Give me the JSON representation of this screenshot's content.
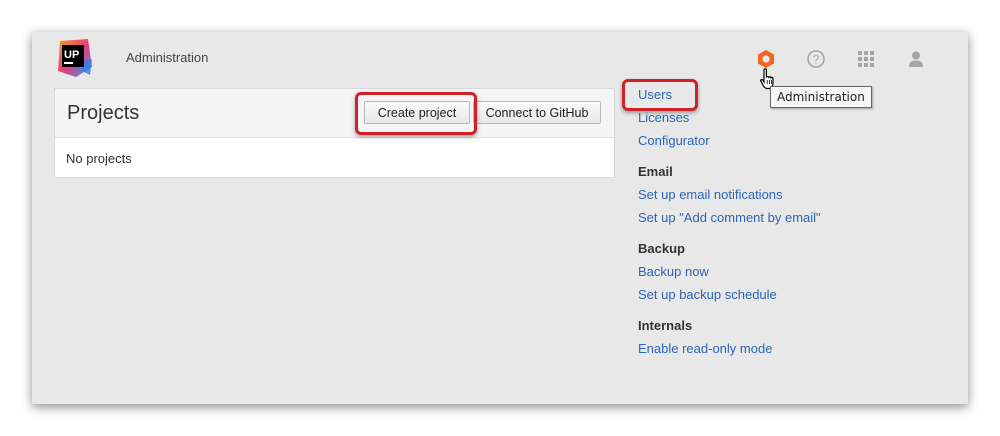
{
  "header": {
    "logo_text": "UP",
    "app_title": "Administration",
    "icons": [
      "hexagon-admin-icon",
      "help-icon",
      "apps-grid-icon",
      "user-icon"
    ],
    "tooltip": "Administration"
  },
  "projects": {
    "title": "Projects",
    "create_label": "Create project",
    "github_label": "Connect to GitHub",
    "empty_text": "No projects"
  },
  "menu": {
    "items": [
      "Users",
      "Licenses",
      "Configurator"
    ],
    "email_heading": "Email",
    "email_items": [
      "Set up email notifications",
      "Set up \"Add comment by email\""
    ],
    "backup_heading": "Backup",
    "backup_items": [
      "Backup now",
      "Set up backup schedule"
    ],
    "internals_heading": "Internals",
    "internals_items": [
      "Enable read-only mode"
    ]
  },
  "colors": {
    "link": "#2b65b8",
    "highlight": "#d0202a",
    "admin_icon": "#f26522"
  }
}
